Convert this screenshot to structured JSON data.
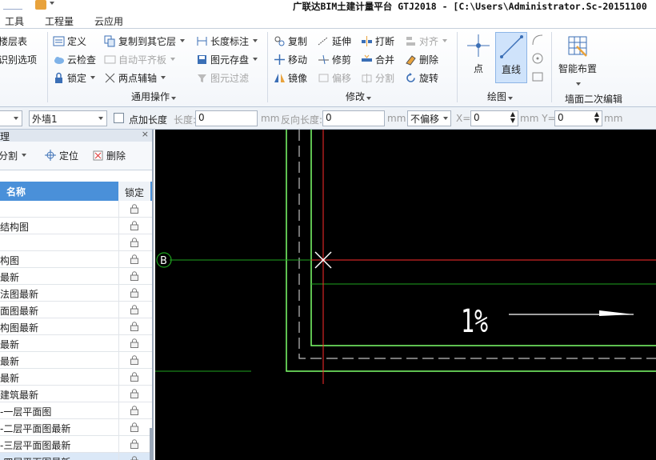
{
  "window": {
    "title": "广联达BIM土建计量平台 GTJ2018 - [C:\\Users\\Administrator.Sc-20151100"
  },
  "menu": {
    "items": [
      "工具",
      "工程量",
      "云应用"
    ]
  },
  "ribbon": {
    "group1": {
      "items": [
        "楼层表",
        "识别选项"
      ]
    },
    "group2": {
      "define": "定义",
      "cloud_check": "云检查",
      "lock": "锁定",
      "copy_to_floor": "复制到其它层",
      "auto_align": "自动平齐板",
      "two_point_axis": "两点辅轴",
      "length_dim": "长度标注",
      "save_element": "图元存盘",
      "element_filter": "图元过滤",
      "label": "通用操作"
    },
    "group3": {
      "copy": "复制",
      "extend": "延伸",
      "break": "打断",
      "align": "对齐",
      "move": "移动",
      "trim": "修剪",
      "merge": "合并",
      "delete": "删除",
      "mirror": "镜像",
      "offset": "偏移",
      "split": "分割",
      "rotate": "旋转",
      "label": "修改"
    },
    "group4": {
      "point": "点",
      "line": "直线",
      "label": "绘图"
    },
    "group5": {
      "smart_layout": "智能布置",
      "label": "墙面二次编辑"
    }
  },
  "propbar": {
    "wall_type": "外墙1",
    "point_length_label": "点加长度",
    "length_label": "长度:",
    "length_value": "0",
    "unit_mm": "mm",
    "reverse_length_label": "反向长度:",
    "reverse_length_value": "0",
    "offset_mode": "不偏移",
    "x_label": "X=",
    "x_value": "0",
    "y_label": "mm Y=",
    "y_value": "0"
  },
  "panel": {
    "title": "理",
    "tools": {
      "split": "分割",
      "locate": "定位",
      "delete": "删除"
    },
    "columns": {
      "name": "名称",
      "lock": "锁定"
    },
    "rows": [
      "",
      "结构图",
      "",
      "构图",
      "最新",
      "法图最新",
      "面图最新",
      "构图最新",
      "最新",
      "最新",
      "最新",
      "建筑最新",
      "-一层平面图",
      "-二层平面图最新",
      "-三层平面图最新",
      "-四层平面图最新"
    ]
  },
  "canvas": {
    "axis_label": "B",
    "slope_text": "1%",
    "colors": {
      "background": "#000000",
      "wall_outline": "#7dff6a",
      "crosshair": "#ff2d2d",
      "axis": "#1fa31f",
      "dash": "#bfbfbf"
    }
  }
}
